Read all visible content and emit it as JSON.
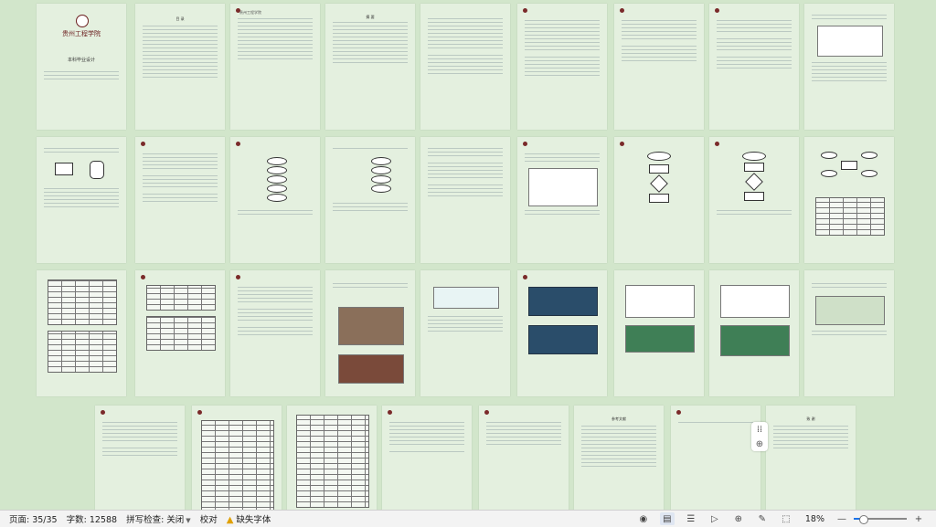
{
  "document": {
    "cover_school": "贵州工程学院",
    "cover_title": "本科毕业设计",
    "running_header": "贵州工程学院",
    "toc_title": "目 录",
    "abstract_title": "摘 要",
    "references_title": "参考文献",
    "thanks_title": "致 谢"
  },
  "status_bar": {
    "page": "页面: 35/35",
    "word_count": "字数: 12588",
    "spell_check": "拼写检查: 关闭",
    "proofread": "校对",
    "missing_font": "缺失字体",
    "zoom": "18%",
    "zoom_level": 0.18
  },
  "icons": {
    "eye": "eye-icon",
    "outline": "outline-view-icon",
    "web_layout": "web-layout-icon",
    "play": "play-icon",
    "globe": "globe-icon",
    "pen": "pen-icon",
    "fit": "fit-page-icon",
    "zoom_out": "zoom-out-icon",
    "zoom_in": "zoom-in-icon"
  },
  "colors": {
    "canvas": "#d2e6cb",
    "page": "#e4f0df",
    "accent": "#1a73e8",
    "warning": "#e0a000"
  }
}
